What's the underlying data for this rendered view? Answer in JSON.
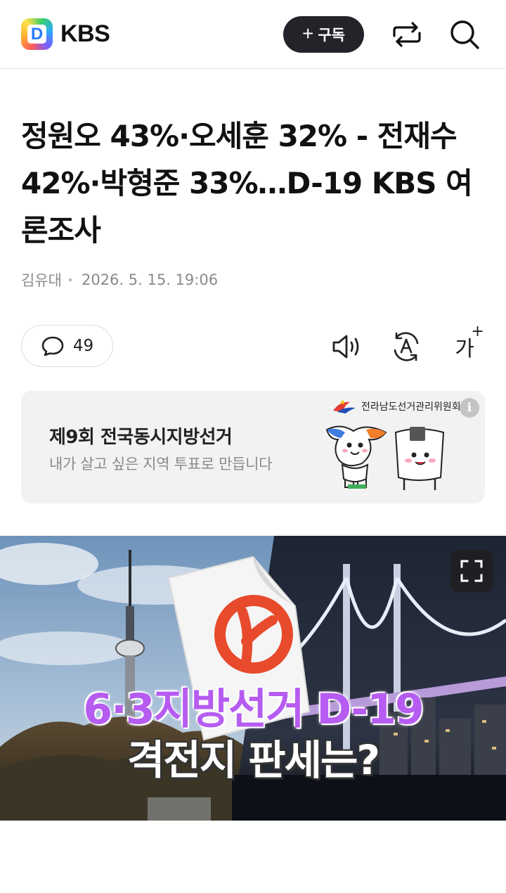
{
  "header": {
    "logo_letter": "D",
    "brand": "KBS",
    "subscribe_plus": "+",
    "subscribe_label": "구독"
  },
  "article": {
    "title": "정원오 43%·오세훈 32% - 전재수 42%·박형준 33%…D-19 KBS 여론조사",
    "author": "김유대",
    "datetime": "2026. 5. 15. 19:06"
  },
  "actions": {
    "comment_count": "49",
    "font_size_label": "가",
    "font_size_plus": "+"
  },
  "banner": {
    "title": "제9회 전국동시지방선거",
    "subtitle": "내가 살고 싶은 지역 투표로 만듭니다",
    "org": "전라남도선거관리위원회",
    "info_symbol": "i"
  },
  "hero": {
    "headline_line1": "6·3지방선거 D-19",
    "headline_line2": "격전지 판세는?"
  },
  "colors": {
    "subscribe_bg": "#222429",
    "banner_bg": "#f2f2f2",
    "hero_headline": "#b65cf0",
    "ballot_mark": "#e84a2c"
  }
}
